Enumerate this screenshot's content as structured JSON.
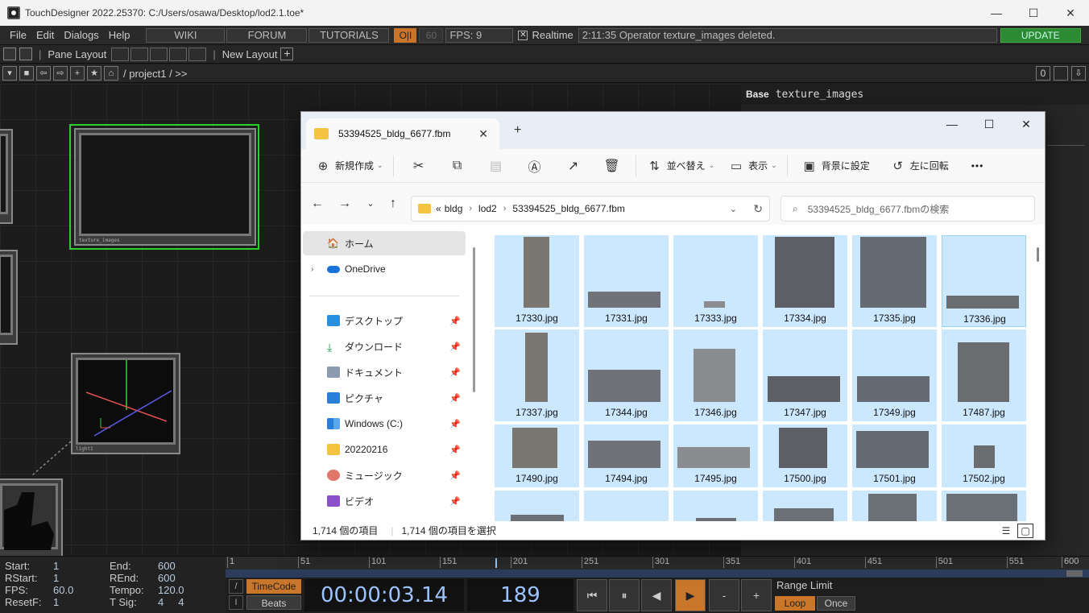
{
  "window": {
    "title": "TouchDesigner 2022.25370: C:/Users/osawa/Desktop/lod2.1.toe*",
    "min": "—",
    "max": "☐",
    "close": "✕"
  },
  "menu": {
    "items": [
      "File",
      "Edit",
      "Dialogs",
      "Help"
    ],
    "wiki": "WIKI",
    "forum": "FORUM",
    "tutorials": "TUTORIALS",
    "oi": "O|I",
    "sixty": "60",
    "fps": "FPS:  9",
    "realtime_check": "✕",
    "realtime": "Realtime",
    "status": "2:11:35 Operator texture_images deleted.",
    "update": "UPDATE"
  },
  "panebar": {
    "pane_layout": "Pane Layout",
    "new_layout": "New Layout",
    "plus": "+"
  },
  "pathbar": {
    "path": "/ project1 / >>",
    "zero": "0"
  },
  "network": {
    "nodes": [
      {
        "label": "texture_images"
      },
      {
        "label": "light1"
      }
    ]
  },
  "param_panel": {
    "type": "Base",
    "name": "texture_images"
  },
  "timeline": {
    "start_label": "Start:",
    "start": "1",
    "rstart_label": "RStart:",
    "rstart": "1",
    "fps_label": "FPS:",
    "fps": "60.0",
    "resetf_label": "ResetF:",
    "resetf": "1",
    "end_label": "End:",
    "end": "600",
    "rend_label": "REnd:",
    "rend": "600",
    "tempo_label": "Tempo:",
    "tempo": "120.0",
    "tsig_label": "T Sig:",
    "tsig": "4     4",
    "ticks": [
      "1",
      "51",
      "101",
      "151",
      "201",
      "251",
      "301",
      "351",
      "401",
      "451",
      "501",
      "551",
      "600"
    ],
    "timecode_btn": "TimeCode",
    "beats_btn": "Beats",
    "slash": "/",
    "i": "I",
    "timecode": "00:00:03.14",
    "frame": "189",
    "controls": [
      "⏮",
      "⏸",
      "◀",
      "▶",
      "-",
      "+"
    ],
    "range_limit": "Range Limit",
    "loop": "Loop",
    "once": "Once"
  },
  "explorer": {
    "tab_title": "53394525_bldg_6677.fbm",
    "tab_close": "✕",
    "new_tab": "+",
    "min": "—",
    "max": "☐",
    "close": "✕",
    "commands": {
      "new": "新規作成",
      "sort": "並べ替え",
      "view": "表示",
      "set_bg": "背景に設定",
      "rotate_left": "左に回転",
      "more": "•••"
    },
    "address": {
      "prefix": "«",
      "crumbs": [
        "bldg",
        "lod2",
        "53394525_bldg_6677.fbm"
      ]
    },
    "search_placeholder": "53394525_bldg_6677.fbmの検索",
    "nav": {
      "home": "ホーム",
      "onedrive": "OneDrive",
      "desktop": "デスクトップ",
      "downloads": "ダウンロード",
      "documents": "ドキュメント",
      "pictures": "ピクチャ",
      "windows_c": "Windows (C:)",
      "folder_2022": "20220216",
      "music": "ミュージック",
      "video": "ビデオ"
    },
    "files": [
      "17330.jpg",
      "17331.jpg",
      "17333.jpg",
      "17334.jpg",
      "17335.jpg",
      "17336.jpg",
      "17337.jpg",
      "17344.jpg",
      "17346.jpg",
      "17347.jpg",
      "17349.jpg",
      "17487.jpg",
      "17490.jpg",
      "17494.jpg",
      "17495.jpg",
      "17500.jpg",
      "17501.jpg",
      "17502.jpg"
    ],
    "status": {
      "count": "1,714 個の項目",
      "selected": "1,714 個の項目を選択"
    }
  }
}
